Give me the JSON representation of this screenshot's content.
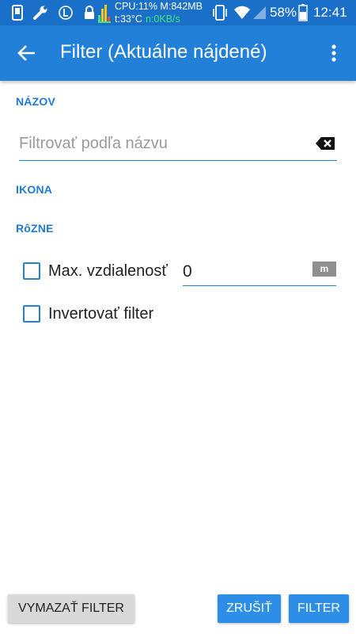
{
  "status_bar": {
    "cpu_text": "CPU:11% M:842MB",
    "temp_text": "t:33°C",
    "net_text": "n:0KB/s",
    "battery_pct": "58%",
    "clock": "12:41",
    "icons": [
      "device-icon",
      "wrench-icon",
      "L-icon",
      "lock-icon",
      "bars-icon",
      "vibrate-icon",
      "wifi-icon",
      "signal-icon",
      "battery-icon"
    ]
  },
  "app_bar": {
    "title": "Filter (Aktuálne nájdené)",
    "back_icon": "arrow-left-icon",
    "menu_icon": "more-vert-icon",
    "color": "#2380d8"
  },
  "sections": {
    "name_label": "NÁZOV",
    "icon_label": "IKONA",
    "misc_label": "RôZNE"
  },
  "name_filter": {
    "placeholder": "Filtrovať podľa názvu",
    "value": ""
  },
  "options": {
    "max_distance_label": "Max. vzdialenosť",
    "max_distance_checked": false,
    "max_distance_value": "0",
    "distance_unit": "m",
    "invert_label": "Invertovať filter",
    "invert_checked": false
  },
  "buttons": {
    "clear_filter": "VYMAZAŤ FILTER",
    "cancel": "ZRUŠIŤ",
    "filter": "FILTER"
  }
}
